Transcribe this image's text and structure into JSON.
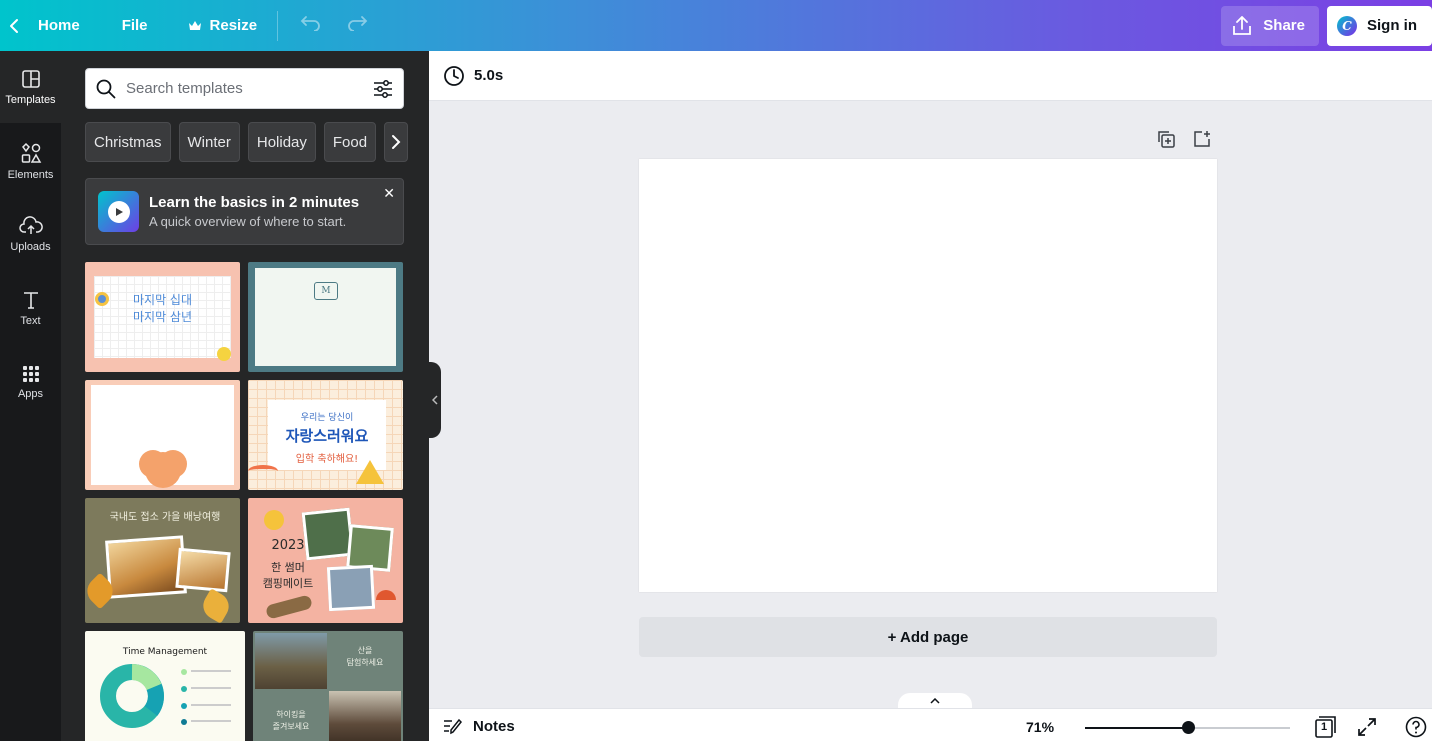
{
  "topbar": {
    "home_label": "Home",
    "file_label": "File",
    "resize_label": "Resize",
    "share_label": "Share",
    "signin_label": "Sign in",
    "logo_letter": "C"
  },
  "rail": {
    "items": [
      {
        "label": "Templates",
        "icon": "templates-icon"
      },
      {
        "label": "Elements",
        "icon": "elements-icon"
      },
      {
        "label": "Uploads",
        "icon": "upload-cloud-icon"
      },
      {
        "label": "Text",
        "icon": "text-icon"
      },
      {
        "label": "Apps",
        "icon": "apps-grid-icon"
      }
    ]
  },
  "panel": {
    "search_placeholder": "Search templates",
    "chips": [
      "Christmas",
      "Winter",
      "Holiday",
      "Food"
    ],
    "learn_title": "Learn the basics in 2 minutes",
    "learn_subtitle": "A quick overview of where to start.",
    "templates": {
      "t1_line1": "마지막 십대",
      "t1_line2": "마지막 삼년",
      "t2_monogram": "M",
      "t4_line1": "우리는 당신이",
      "t4_line2": "자랑스러워요",
      "t4_line3": "입학 축하해요!",
      "t5_title": "국내도 접소 가을 배낭여행",
      "t6_year": "2023",
      "t6_line1": "한 썸머",
      "t6_line2": "캠핑메이트",
      "t7_title": "Time Management",
      "t8_text1": "산을",
      "t8_text2": "탐험하세요",
      "t8_text3": "하이킹을",
      "t8_text4": "즐겨보세요"
    }
  },
  "toolbar": {
    "duration": "5.0s"
  },
  "canvas": {
    "add_page_label": "+ Add page"
  },
  "bottombar": {
    "notes_label": "Notes",
    "zoom_label": "71%",
    "zoom_fraction": 0.5,
    "page_count": "1"
  },
  "colors": {
    "topbar_gradient_start": "#00c4cc",
    "topbar_gradient_end": "#7b3fe4",
    "panel_bg": "#252627",
    "rail_bg": "#18191b",
    "workspace_bg": "#ebecf0"
  }
}
